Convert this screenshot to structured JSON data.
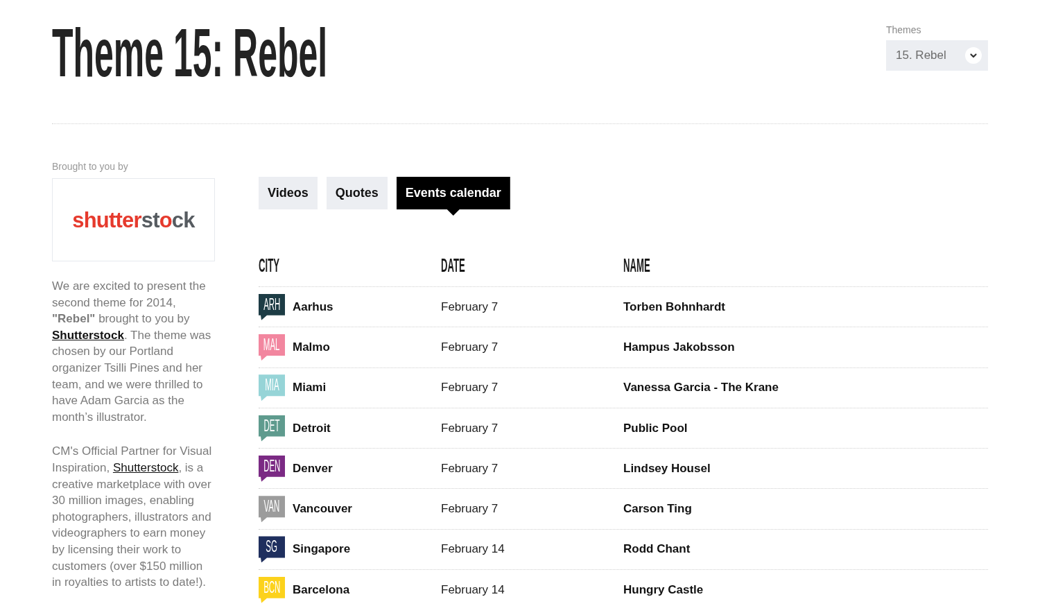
{
  "header": {
    "title": "Theme 15: Rebel",
    "themes_select": {
      "label": "Themes",
      "value": "15. Rebel"
    }
  },
  "sidebar": {
    "caption": "Brought to you by",
    "logo": [
      "shutter",
      "st",
      "o",
      "ck"
    ],
    "paragraphs": [
      {
        "parts": [
          {
            "kind": "text",
            "text": "We are excited to present the second theme for 2014, **\"Rebel\"** brought to you by "
          },
          {
            "kind": "link",
            "text": "Shutterstock",
            "bold": true
          },
          {
            "kind": "text",
            "text": ". The theme was chosen by our Portland organizer Tsilli Pines and her team, and we were thrilled to have Adam Garcia as the month’s illustrator."
          }
        ]
      },
      {
        "parts": [
          {
            "kind": "text",
            "text": "CM's Official Partner for Visual Inspiration, "
          },
          {
            "kind": "link",
            "text": "Shutterstock",
            "bold": false
          },
          {
            "kind": "text",
            "text": ", is a creative marketplace with over 30 million images, enabling photographers, illustrators and videographers to earn money by licensing their work to customers (over $150 million in royalties to artists to date!)."
          }
        ]
      }
    ]
  },
  "tabs": [
    {
      "label": "Videos",
      "selected": false
    },
    {
      "label": "Quotes",
      "selected": false
    },
    {
      "label": "Events calendar",
      "selected": true
    }
  ],
  "table": {
    "columns": [
      "CITY",
      "DATE",
      "NAME"
    ],
    "rows": [
      {
        "code": "ARH",
        "color": "#1d3c45",
        "city": "Aarhus",
        "date": "February 7",
        "name": "Torben Bohnhardt"
      },
      {
        "code": "MAL",
        "color": "#f2869f",
        "city": "Malmo",
        "date": "February 7",
        "name": "Hampus Jakobsson"
      },
      {
        "code": "MIA",
        "color": "#96d4d7",
        "city": "Miami",
        "date": "February 7",
        "name": "Vanessa Garcia - The Krane"
      },
      {
        "code": "DET",
        "color": "#5f9b8e",
        "city": "Detroit",
        "date": "February 7",
        "name": "Public Pool"
      },
      {
        "code": "DEN",
        "color": "#7b2a84",
        "city": "Denver",
        "date": "February 7",
        "name": "Lindsey Housel"
      },
      {
        "code": "VAN",
        "color": "#9c9c9c",
        "city": "Vancouver",
        "date": "February 7",
        "name": "Carson Ting"
      },
      {
        "code": "SG",
        "color": "#1f2f5e",
        "city": "Singapore",
        "date": "February 14",
        "name": "Rodd Chant"
      },
      {
        "code": "BCN",
        "color": "#fcd21c",
        "city": "Barcelona",
        "date": "February 14",
        "name": "Hungry Castle"
      }
    ]
  }
}
